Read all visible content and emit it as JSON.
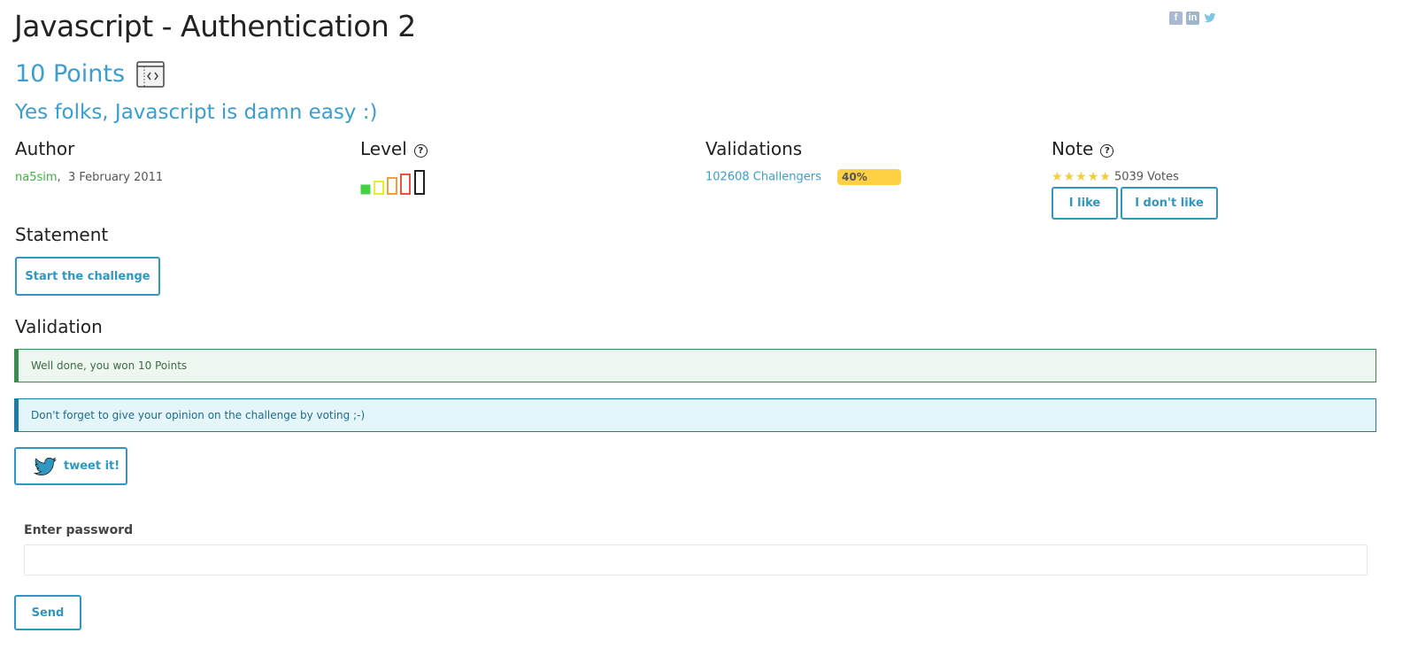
{
  "page": {
    "title": "Javascript - Authentication 2",
    "points": "10 Points",
    "subtitle": "Yes folks, Javascript is damn easy :)"
  },
  "social": {
    "facebook": "f",
    "linkedin": "in",
    "twitter": "t"
  },
  "author": {
    "heading": "Author",
    "name": "na5sim",
    "separator": ",",
    "date": "3 February 2011"
  },
  "level": {
    "heading": "Level",
    "help": "?",
    "current": 1,
    "max": 5
  },
  "validations": {
    "heading": "Validations",
    "challengers": "102608 Challengers",
    "percent_label": "40%",
    "percent": 40
  },
  "note": {
    "heading": "Note",
    "help": "?",
    "stars": 5,
    "votes": "5039 Votes",
    "like_label": "I like",
    "dislike_label": "I don't like"
  },
  "statement": {
    "heading": "Statement",
    "start_label": "Start the challenge"
  },
  "validation": {
    "heading": "Validation",
    "success_message": "Well done, you won 10 Points",
    "info_message": "Don't forget to give your opinion on the challenge by voting ;-)",
    "tweet_label": "tweet it!"
  },
  "form": {
    "password_label": "Enter password",
    "password_value": "",
    "send_label": "Send"
  },
  "colors": {
    "accent": "#3a9fd0",
    "success": "#3c8a4f",
    "info": "#1f7da3",
    "progress": "#ffcf44",
    "author": "#3bb53b"
  },
  "icons": [
    "web-challenge-icon",
    "help-icon",
    "star-icon",
    "twitter-bird-icon",
    "facebook-icon",
    "linkedin-icon",
    "twitter-icon"
  ]
}
